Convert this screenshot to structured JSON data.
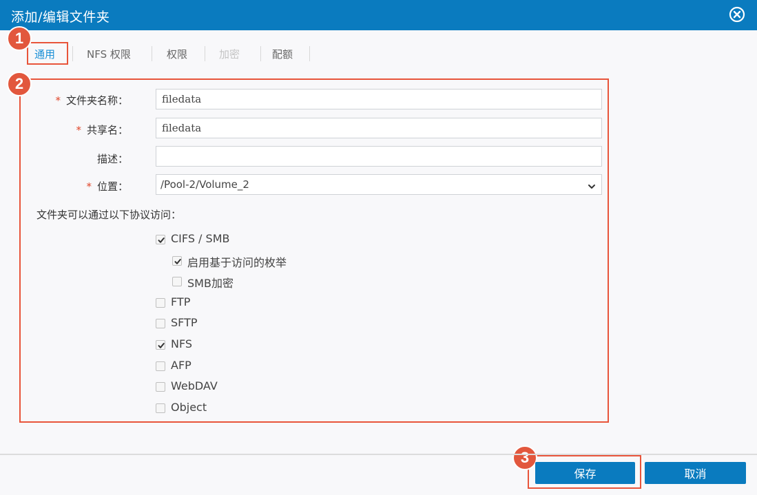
{
  "dialog": {
    "title": "添加/编辑文件夹",
    "close_icon": "close-circle-icon"
  },
  "tabs": [
    {
      "label": "通用",
      "state": "active"
    },
    {
      "label": "NFS 权限",
      "state": "normal"
    },
    {
      "label": "权限",
      "state": "normal"
    },
    {
      "label": "加密",
      "state": "disabled"
    },
    {
      "label": "配额",
      "state": "normal"
    }
  ],
  "badges": [
    "1",
    "2",
    "3"
  ],
  "form": {
    "required_mark": "*",
    "folder_name": {
      "label": "文件夹名称：",
      "value": "filedata"
    },
    "share_name": {
      "label": "共享名：",
      "value": "filedata"
    },
    "description": {
      "label": "描述：",
      "value": ""
    },
    "location": {
      "label": "位置：",
      "value": "/Pool-2/Volume_2"
    }
  },
  "protocols": {
    "heading": "文件夹可以通过以下协议访问：",
    "items": [
      {
        "label": "CIFS / SMB",
        "checked": true
      },
      {
        "label": "启用基于访问的枚举",
        "checked": true
      },
      {
        "label": "SMB加密",
        "checked": false
      },
      {
        "label": "FTP",
        "checked": false
      },
      {
        "label": "SFTP",
        "checked": false
      },
      {
        "label": "NFS",
        "checked": true
      },
      {
        "label": "AFP",
        "checked": false
      },
      {
        "label": "WebDAV",
        "checked": false
      },
      {
        "label": "Object",
        "checked": false
      }
    ]
  },
  "footer": {
    "save_label": "保存",
    "cancel_label": "取消"
  },
  "colors": {
    "titlebar": "#0a7bbf",
    "active_tab": "#1a8fd6",
    "highlight": "#e8543a",
    "required": "#e0462a"
  }
}
